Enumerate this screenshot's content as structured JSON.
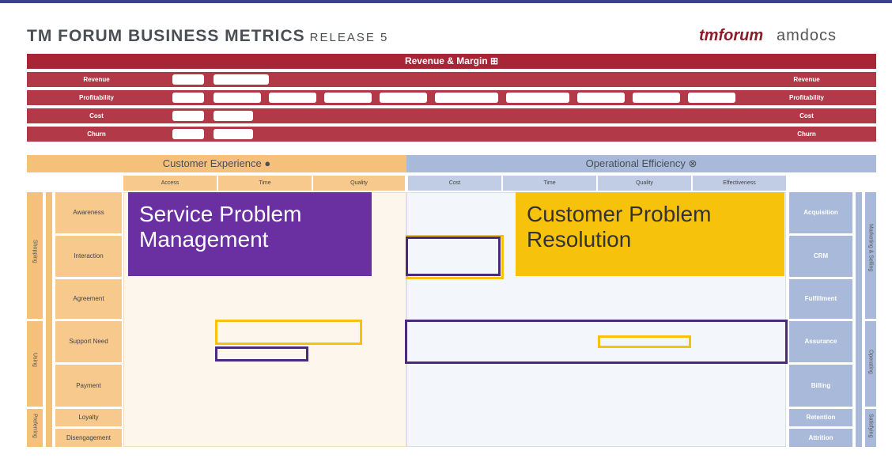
{
  "header": {
    "title": "TM FORUM BUSINESS METRICS",
    "release": "RELEASE 5",
    "logo_tm": "tmforum",
    "logo_amdocs": "amdocs"
  },
  "revenue": {
    "bar_title": "Revenue & Margin",
    "rows": [
      {
        "label": "Revenue"
      },
      {
        "label": "Profitability"
      },
      {
        "label": "Cost"
      },
      {
        "label": "Churn"
      }
    ]
  },
  "cx": {
    "title": "Customer Experience",
    "subs": [
      "Access",
      "Time",
      "Quality"
    ]
  },
  "oe": {
    "title": "Operational Efficiency",
    "subs": [
      "Cost",
      "Time",
      "Quality",
      "Effectiveness"
    ]
  },
  "rows": [
    "Awareness",
    "Interaction",
    "Agreement",
    "Support Need",
    "Payment",
    "Loyalty",
    "Disengagement"
  ],
  "right_labels": [
    "Acquisition",
    "CRM",
    "Fulfillment",
    "Assurance",
    "Billing",
    "Retention",
    "Attrition"
  ],
  "left_side": [
    "Shopping",
    "Using",
    "Preferring"
  ],
  "right_side": [
    "Marketing & Selling",
    "Operating",
    "Satisfying"
  ],
  "overlays": {
    "service": "Service Problem Management",
    "customer": "Customer Problem Resolution"
  },
  "colors": {
    "revenue_red": "#a82535",
    "cx_orange": "#f5c07a",
    "oe_blue": "#a8b9d9",
    "purple": "#6a2fa0",
    "gold": "#f6c20b"
  }
}
